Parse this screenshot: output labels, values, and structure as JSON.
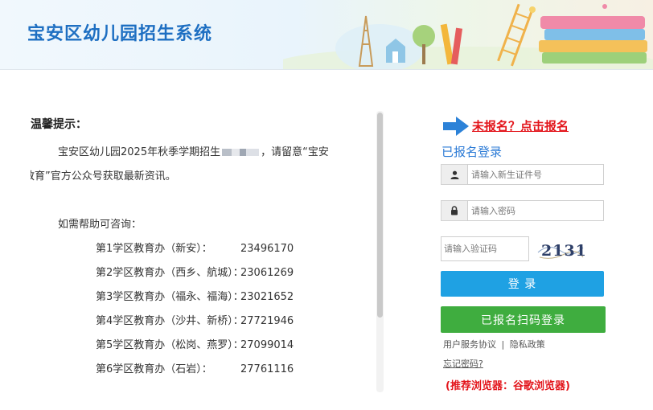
{
  "header": {
    "title": "宝安区幼儿园招生系统"
  },
  "notice": {
    "title": "温馨提示：",
    "line1_before": "宝安区幼儿园2025年秋季学期招生",
    "line1_after": "，请留意“宝安",
    "line2": "教育”官方公众号获取最新资讯。",
    "help": "如需帮助可咨询：",
    "contacts": [
      {
        "name": "第1学区教育办（新安）：",
        "phone": "23496170"
      },
      {
        "name": "第2学区教育办（西乡、航城）：",
        "phone": "23061269"
      },
      {
        "name": "第3学区教育办（福永、福海）：",
        "phone": "23021652"
      },
      {
        "name": "第4学区教育办（沙井、新桥）：",
        "phone": "27721946"
      },
      {
        "name": "第5学区教育办（松岗、燕罗）：",
        "phone": "27099014"
      },
      {
        "name": "第6学区教育办（石岩）：",
        "phone": "27761116"
      }
    ]
  },
  "login": {
    "register_link": "未报名？点击报名",
    "title": "已报名登录",
    "id_placeholder": "请输入新生证件号",
    "password_placeholder": "请输入密码",
    "captcha_placeholder": "请输入验证码",
    "captcha_text": "2131",
    "login_button": "登 录",
    "scan_button": "已报名扫码登录",
    "user_agreement": "用户服务协议",
    "privacy": "隐私政策",
    "separator": "|",
    "forgot": "忘记密码?",
    "browser_tip": "(推荐浏览器：谷歌浏览器)"
  },
  "colors": {
    "brand_blue": "#1e6fc2",
    "login_button": "#1fa1e3",
    "scan_button": "#3fad3f",
    "alert_red": "#e3161c"
  },
  "icons": [
    "user-icon",
    "lock-icon",
    "arrow-right-icon",
    "captcha-image"
  ]
}
